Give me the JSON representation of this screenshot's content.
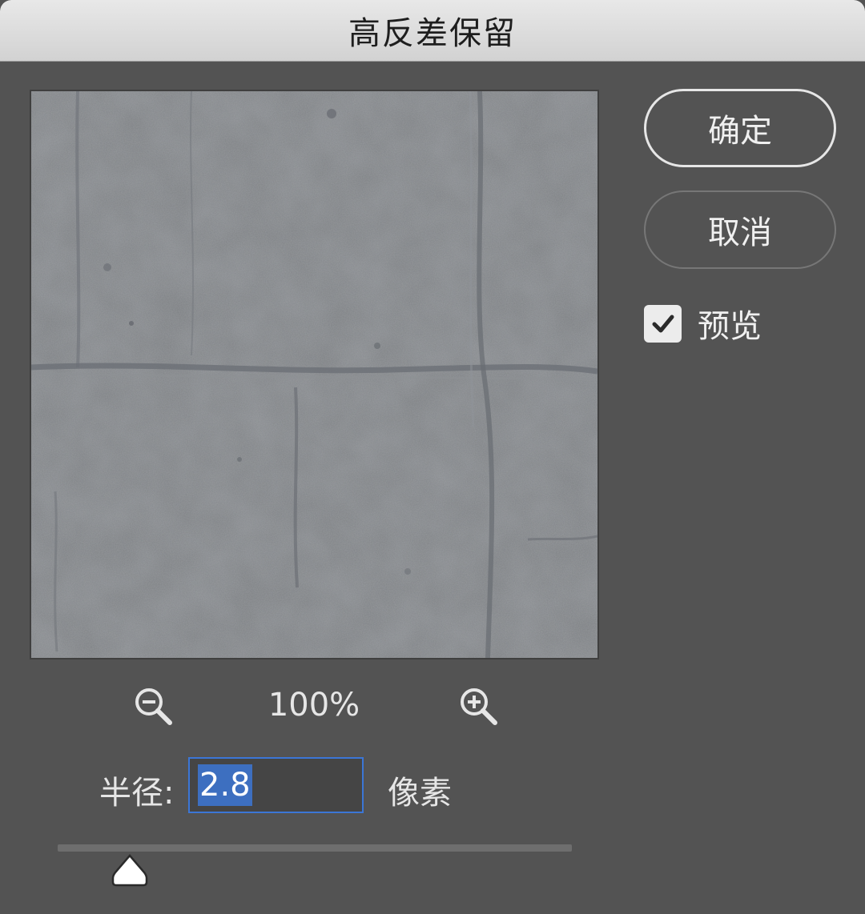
{
  "dialog": {
    "title": "高反差保留"
  },
  "buttons": {
    "ok_label": "确定",
    "cancel_label": "取消"
  },
  "preview_option": {
    "label": "预览",
    "checked": true
  },
  "zoom": {
    "level": "100%",
    "zoom_out_icon": "zoom-out-magnifier",
    "zoom_in_icon": "zoom-in-magnifier"
  },
  "radius": {
    "label": "半径:",
    "value": "2.8",
    "unit": "像素",
    "slider_fraction": 0.14
  },
  "colors": {
    "accent": "#3b76d6",
    "dialog_bg": "#535353",
    "preview_gray": "#7a7d80"
  }
}
